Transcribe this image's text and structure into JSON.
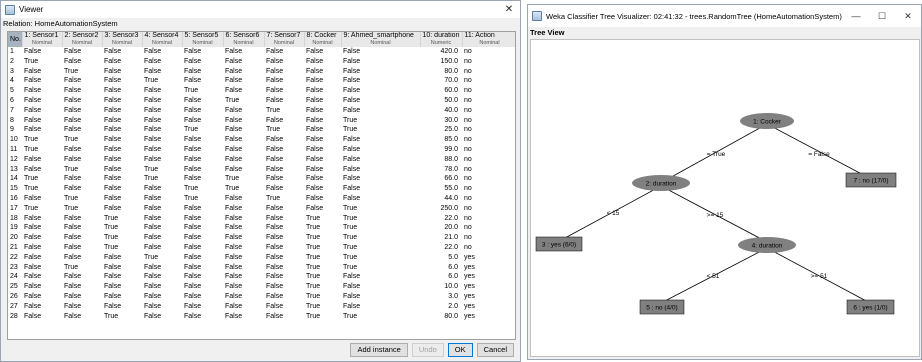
{
  "viewer": {
    "title": "Viewer",
    "close_glyph": "✕",
    "relation": "Relation: HomeAutomationSystem",
    "columns": [
      {
        "name": "No.",
        "type": ""
      },
      {
        "name": "1: Sensor1",
        "type": "Nominal"
      },
      {
        "name": "2: Sensor2",
        "type": "Nominal"
      },
      {
        "name": "3: Sensor3",
        "type": "Nominal"
      },
      {
        "name": "4: Sensor4",
        "type": "Nominal"
      },
      {
        "name": "5: Sensor5",
        "type": "Nominal"
      },
      {
        "name": "6: Sensor6",
        "type": "Nominal"
      },
      {
        "name": "7: Sensor7",
        "type": "Nominal"
      },
      {
        "name": "8: Cocker",
        "type": "Nominal"
      },
      {
        "name": "9: Ahmed_smartphone",
        "type": "Nominal"
      },
      {
        "name": "10: duration",
        "type": "Numeric"
      },
      {
        "name": "11: Action",
        "type": "Nominal"
      }
    ],
    "rows": [
      [
        "1",
        "False",
        "False",
        "False",
        "False",
        "False",
        "False",
        "False",
        "False",
        "False",
        "420.0",
        "no"
      ],
      [
        "2",
        "True",
        "False",
        "False",
        "False",
        "False",
        "False",
        "False",
        "False",
        "False",
        "150.0",
        "no"
      ],
      [
        "3",
        "False",
        "True",
        "False",
        "False",
        "False",
        "False",
        "False",
        "False",
        "False",
        "80.0",
        "no"
      ],
      [
        "4",
        "False",
        "False",
        "False",
        "True",
        "False",
        "False",
        "False",
        "False",
        "False",
        "70.0",
        "no"
      ],
      [
        "5",
        "False",
        "False",
        "False",
        "False",
        "True",
        "False",
        "False",
        "False",
        "False",
        "60.0",
        "no"
      ],
      [
        "6",
        "False",
        "False",
        "False",
        "False",
        "False",
        "True",
        "False",
        "False",
        "False",
        "50.0",
        "no"
      ],
      [
        "7",
        "False",
        "False",
        "False",
        "False",
        "False",
        "False",
        "True",
        "False",
        "False",
        "40.0",
        "no"
      ],
      [
        "8",
        "False",
        "False",
        "False",
        "False",
        "False",
        "False",
        "False",
        "False",
        "True",
        "30.0",
        "no"
      ],
      [
        "9",
        "False",
        "False",
        "False",
        "False",
        "True",
        "False",
        "True",
        "False",
        "True",
        "25.0",
        "no"
      ],
      [
        "10",
        "True",
        "True",
        "False",
        "False",
        "False",
        "False",
        "False",
        "False",
        "False",
        "85.0",
        "no"
      ],
      [
        "11",
        "True",
        "False",
        "False",
        "False",
        "False",
        "False",
        "False",
        "False",
        "False",
        "99.0",
        "no"
      ],
      [
        "12",
        "False",
        "False",
        "False",
        "False",
        "False",
        "False",
        "False",
        "False",
        "False",
        "88.0",
        "no"
      ],
      [
        "13",
        "False",
        "True",
        "False",
        "True",
        "False",
        "False",
        "False",
        "False",
        "False",
        "78.0",
        "no"
      ],
      [
        "14",
        "True",
        "False",
        "False",
        "True",
        "False",
        "True",
        "False",
        "False",
        "False",
        "66.0",
        "no"
      ],
      [
        "15",
        "True",
        "False",
        "False",
        "False",
        "True",
        "True",
        "False",
        "False",
        "False",
        "55.0",
        "no"
      ],
      [
        "16",
        "False",
        "True",
        "False",
        "False",
        "True",
        "False",
        "True",
        "False",
        "False",
        "44.0",
        "no"
      ],
      [
        "17",
        "True",
        "True",
        "False",
        "False",
        "False",
        "False",
        "False",
        "False",
        "True",
        "250.0",
        "no"
      ],
      [
        "18",
        "False",
        "False",
        "True",
        "False",
        "False",
        "False",
        "False",
        "True",
        "True",
        "22.0",
        "no"
      ],
      [
        "19",
        "False",
        "False",
        "True",
        "False",
        "False",
        "False",
        "False",
        "True",
        "True",
        "20.0",
        "no"
      ],
      [
        "20",
        "False",
        "False",
        "True",
        "False",
        "False",
        "False",
        "False",
        "True",
        "True",
        "21.0",
        "no"
      ],
      [
        "21",
        "False",
        "False",
        "True",
        "False",
        "False",
        "False",
        "False",
        "True",
        "True",
        "22.0",
        "no"
      ],
      [
        "22",
        "False",
        "False",
        "False",
        "True",
        "False",
        "False",
        "False",
        "True",
        "True",
        "5.0",
        "yes"
      ],
      [
        "23",
        "False",
        "True",
        "False",
        "False",
        "False",
        "False",
        "False",
        "True",
        "True",
        "6.0",
        "yes"
      ],
      [
        "24",
        "False",
        "False",
        "False",
        "False",
        "False",
        "False",
        "False",
        "True",
        "False",
        "6.0",
        "yes"
      ],
      [
        "25",
        "False",
        "False",
        "False",
        "False",
        "False",
        "False",
        "False",
        "True",
        "False",
        "10.0",
        "yes"
      ],
      [
        "26",
        "False",
        "False",
        "False",
        "False",
        "False",
        "False",
        "False",
        "True",
        "False",
        "3.0",
        "yes"
      ],
      [
        "27",
        "False",
        "False",
        "False",
        "False",
        "False",
        "False",
        "False",
        "True",
        "False",
        "2.0",
        "yes"
      ],
      [
        "28",
        "False",
        "False",
        "True",
        "False",
        "False",
        "False",
        "False",
        "True",
        "True",
        "80.0",
        "yes"
      ]
    ],
    "buttons": {
      "add_instance": "Add instance",
      "undo": "Undo",
      "ok": "OK",
      "cancel": "Cancel"
    }
  },
  "tree_window": {
    "title": "Weka Classifier Tree Visualizer: 02:41:32 - trees.RandomTree (HomeAutomationSystem)",
    "minimize_glyph": "—",
    "maximize_glyph": "☐",
    "close_glyph": "✕",
    "tree_view_label": "Tree View",
    "node_color": "#808080",
    "nodes": {
      "root": "1: Cocker",
      "duration_left": "2: duration",
      "leaf_no_17": "7 : no (17/0)",
      "leaf_yes_6": "3 : yes (6/0)",
      "duration_right": "4: duration",
      "leaf_no_4": "5 : no (4/0)",
      "leaf_yes_1": "6 : yes (1/0)"
    },
    "edges": {
      "root_true": "= True",
      "root_false": "= False",
      "lt15": "< 15",
      "ge15": ">= 15",
      "lt51": "< 51",
      "ge51": ">= 51"
    }
  }
}
